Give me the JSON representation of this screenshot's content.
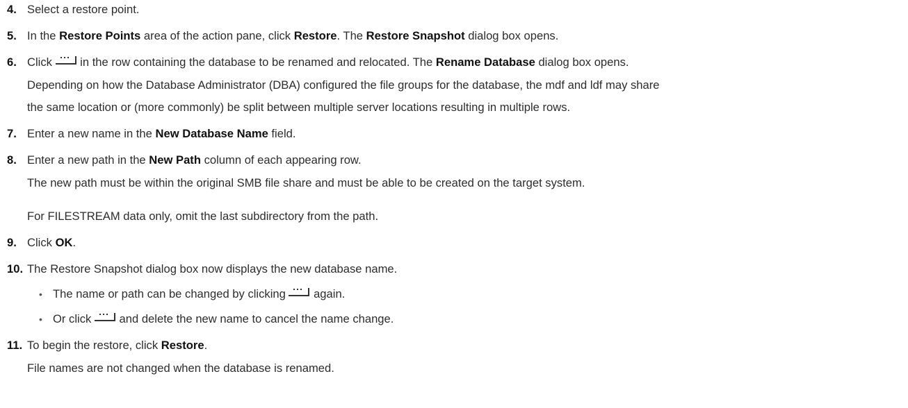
{
  "steps": [
    {
      "num": "4.",
      "parts": [
        "Select a restore point."
      ]
    },
    {
      "num": "5.",
      "parts": [
        "In the ",
        "Restore Points",
        " area of the action pane, click ",
        "Restore",
        ". The ",
        "Restore Snapshot",
        " dialog box opens."
      ]
    },
    {
      "num": "6.",
      "parts": [
        "Click ",
        " in the row containing the database to be renamed and relocated. The ",
        "Rename Database",
        " dialog box opens."
      ],
      "notes": [
        "Depending on how the Database Administrator (DBA) configured the file groups for the database, the mdf and ldf may share",
        "the same location or (more commonly) be split between multiple server locations resulting in multiple rows."
      ]
    },
    {
      "num": "7.",
      "parts": [
        "Enter a new name in the ",
        "New Database Name",
        " field."
      ]
    },
    {
      "num": "8.",
      "parts": [
        "Enter a new path in the ",
        "New Path",
        " column of each appearing row."
      ],
      "notes": [
        "The new path must be within the original SMB file share and must be able to be created on the target system.",
        "For FILESTREAM data only, omit the last subdirectory from the path."
      ]
    },
    {
      "num": "9.",
      "parts": [
        "Click ",
        "OK",
        "."
      ]
    },
    {
      "num": "10.",
      "parts": [
        "The Restore Snapshot dialog box now displays the new database name."
      ],
      "bullets": [
        [
          "The name or path can be changed by clicking ",
          " again."
        ],
        [
          "Or click ",
          " and delete the new name to cancel the name change."
        ]
      ]
    },
    {
      "num": "11.",
      "parts": [
        "To begin the restore, click ",
        "Restore",
        "."
      ],
      "notes": [
        "File names are not changed when the database is renamed."
      ]
    }
  ],
  "icons": {
    "browse": "browse-ellipsis-icon"
  }
}
